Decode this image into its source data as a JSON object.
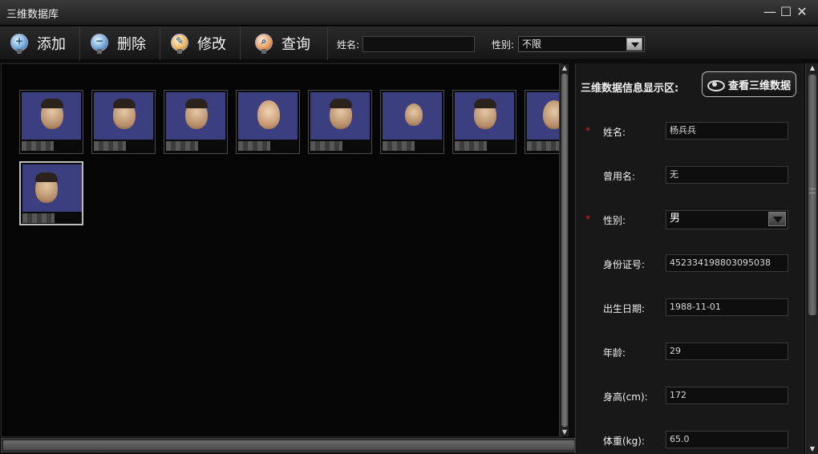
{
  "window": {
    "title": "三维数据库",
    "minimize": "—",
    "maximize": "☐",
    "close": "✕"
  },
  "toolbar": {
    "add_label": "添加",
    "delete_label": "删除",
    "modify_label": "修改",
    "query_label": "查询",
    "name_filter_label": "姓名:",
    "name_filter_value": "",
    "gender_filter_label": "性别:",
    "gender_filter_value": "不限"
  },
  "gallery": {
    "count": 9,
    "selected_index": 8
  },
  "panel": {
    "title": "三维数据信息显示区:",
    "view3d_button": "查看三维数据",
    "required_mark": "*",
    "fields": {
      "name": {
        "label": "姓名:",
        "value": "杨兵兵"
      },
      "former_name": {
        "label": "曾用名:",
        "value": "无"
      },
      "gender": {
        "label": "性别:",
        "value": "男"
      },
      "id_number": {
        "label": "身份证号:",
        "value": "452334198803095038"
      },
      "birth_date": {
        "label": "出生日期:",
        "value": "1988-11-01"
      },
      "age": {
        "label": "年龄:",
        "value": "29"
      },
      "height": {
        "label": "身高(cm):",
        "value": "172"
      },
      "weight": {
        "label": "体重(kg):",
        "value": "65.0"
      }
    }
  }
}
